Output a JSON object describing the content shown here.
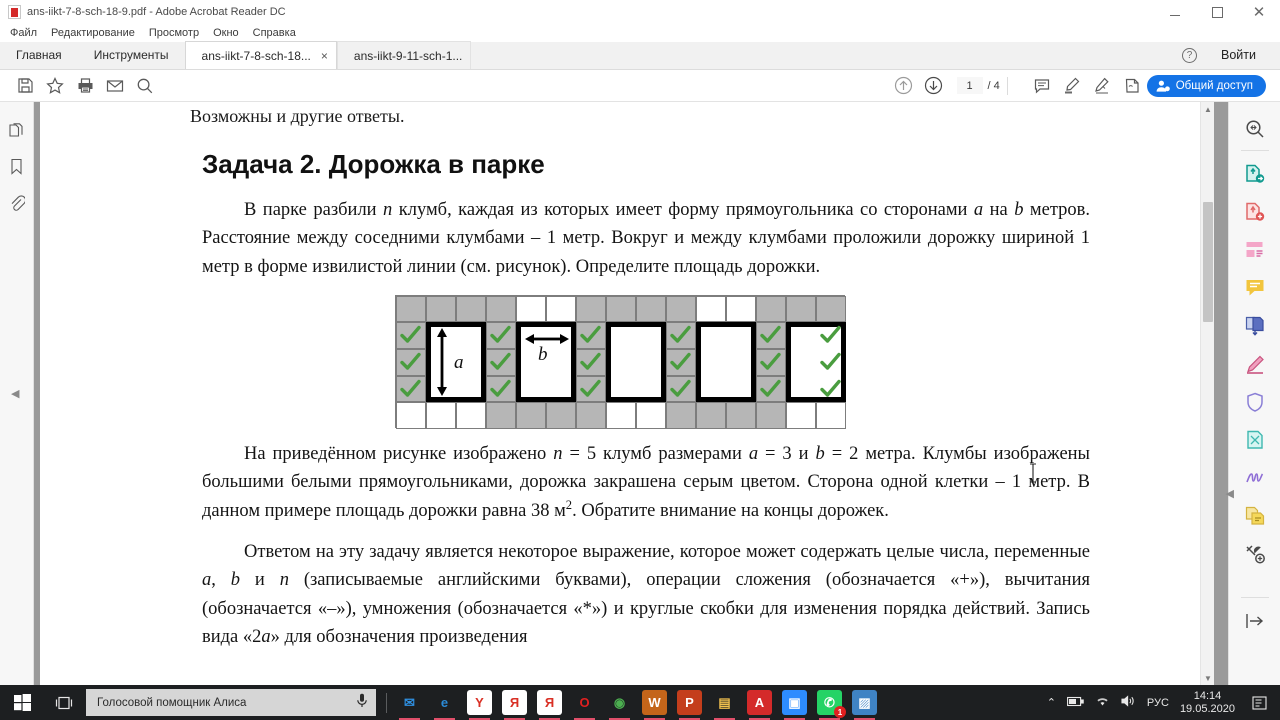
{
  "window": {
    "title": "ans-iikt-7-8-sch-18-9.pdf - Adobe Acrobat Reader DC",
    "app_icon": "pdf-file-icon",
    "controls": {
      "minimize": "minimize-icon",
      "maximize": "maximize-icon",
      "close": "close-icon"
    }
  },
  "menubar": {
    "items": [
      {
        "label": "Файл"
      },
      {
        "label": "Редактирование"
      },
      {
        "label": "Просмотр"
      },
      {
        "label": "Окно"
      },
      {
        "label": "Справка"
      }
    ]
  },
  "tabbar": {
    "home": "Главная",
    "tools": "Инструменты",
    "documents": [
      {
        "label": "ans-iikt-7-8-sch-18...",
        "active": true,
        "close": "×"
      },
      {
        "label": "ans-iikt-9-11-sch-1...",
        "active": false
      }
    ],
    "help": "?",
    "signin": "Войти"
  },
  "toolbar": {
    "icons": [
      "save-icon",
      "star-icon",
      "print-icon",
      "email-icon",
      "zoom-search-icon",
      "scroll-up-icon",
      "scroll-down-icon"
    ],
    "page_current": "1",
    "page_total": "/ 4",
    "right_icons": [
      "comment-icon",
      "highlight-icon",
      "sign-icon",
      "stamp-icon"
    ],
    "share_label": "Общий доступ",
    "share_icon": "share-person-icon",
    "share_color": "#1473e6"
  },
  "left_rail": {
    "icons": [
      "page-thumbnails-icon",
      "bookmark-icon",
      "attachment-icon"
    ],
    "collapse_arrow": "◀"
  },
  "right_rail": {
    "icons": [
      "zoom-search-icon",
      "export-pdf-icon",
      "create-pdf-icon",
      "edit-pdf-icon",
      "comment-icon",
      "combine-files-icon",
      "fill-and-sign-icon",
      "protect-icon",
      "compress-icon",
      "signature-icon",
      "organize-pages-icon",
      "more-tools-icon",
      "collapse-panel-icon"
    ],
    "collapse_arrow": "◀"
  },
  "document": {
    "pre_line": "Возможны и другие ответы.",
    "task_title": "Задача 2. Дорожка в парке",
    "paragraph_1": {
      "runs": [
        {
          "t": "В парке разбили ",
          "i": false
        },
        {
          "t": "n",
          "i": true
        },
        {
          "t": " клумб, каждая из которых имеет форму прямоугольника со сторонами ",
          "i": false
        },
        {
          "t": "a",
          "i": true
        },
        {
          "t": " на ",
          "i": false
        },
        {
          "t": "b",
          "i": true
        },
        {
          "t": " метров. Расстояние между соседними клумбами – 1 метр. Вокруг и между клумбами проложили дорожку шириной 1 метр в форме извилистой линии (см. рисунок). Определите площадь дорожки.",
          "i": false
        }
      ]
    },
    "paragraph_2": {
      "runs": [
        {
          "t": "На приведённом рисунке изображено ",
          "i": false
        },
        {
          "t": "n",
          "i": true
        },
        {
          "t": " = 5 клумб размерами ",
          "i": false
        },
        {
          "t": "a",
          "i": true
        },
        {
          "t": " = 3 и ",
          "i": false
        },
        {
          "t": "b",
          "i": true
        },
        {
          "t": " = 2 метра. Клумбы изображены большими белыми прямоугольниками, дорожка закрашена серым цветом. Сторона одной клетки – 1 метр. В данном примере площадь дорожки равна 38 м",
          "i": false
        },
        {
          "t": "2",
          "i": false,
          "sup": true
        },
        {
          "t": ". Обратите внимание на концы дорожек.",
          "i": false
        }
      ]
    },
    "paragraph_3": {
      "runs": [
        {
          "t": "Ответом на эту задачу является некоторое выражение, которое может содержать целые числа, переменные ",
          "i": false
        },
        {
          "t": "a",
          "i": true
        },
        {
          "t": ", ",
          "i": false
        },
        {
          "t": "b",
          "i": true
        },
        {
          "t": " и ",
          "i": false
        },
        {
          "t": "n",
          "i": true
        },
        {
          "t": " (записываемые английскими буквами), операции сложения (обозначается «+»), вычитания (обозначается «–»), умножения (обозначается «*») и круглые скобки для изменения порядка действий. Запись вида «2",
          "i": false
        },
        {
          "t": "a",
          "i": true
        },
        {
          "t": "» для обозначения произведения",
          "i": false
        }
      ]
    },
    "figure": {
      "label_a": "a",
      "label_b": "b",
      "cols": 15,
      "rows": 5,
      "cell_colors": [
        [
          "grey",
          "grey",
          "grey",
          "grey",
          "white",
          "white",
          "grey",
          "grey",
          "grey",
          "grey",
          "white",
          "white",
          "grey",
          "grey",
          "grey"
        ],
        [
          "grey",
          "grey",
          "grey",
          "grey",
          "grey",
          "grey",
          "grey",
          "grey",
          "grey",
          "grey",
          "grey",
          "grey",
          "grey",
          "grey",
          "grey"
        ],
        [
          "grey",
          "grey",
          "grey",
          "grey",
          "grey",
          "grey",
          "grey",
          "grey",
          "grey",
          "grey",
          "grey",
          "grey",
          "grey",
          "grey",
          "grey"
        ],
        [
          "grey",
          "grey",
          "grey",
          "grey",
          "grey",
          "grey",
          "grey",
          "grey",
          "grey",
          "grey",
          "grey",
          "grey",
          "grey",
          "grey",
          "grey"
        ],
        [
          "white",
          "white",
          "white",
          "grey",
          "grey",
          "grey",
          "grey",
          "white",
          "white",
          "grey",
          "grey",
          "grey",
          "grey",
          "white",
          "white"
        ]
      ],
      "beds": [
        {
          "col": 1,
          "row": 1,
          "w": 2,
          "h": 3
        },
        {
          "col": 4,
          "row": 1,
          "w": 2,
          "h": 3
        },
        {
          "col": 7,
          "row": 1,
          "w": 2,
          "h": 3
        },
        {
          "col": 10,
          "row": 1,
          "w": 2,
          "h": 3
        },
        {
          "col": 13,
          "row": 1,
          "w": 2,
          "h": 3
        }
      ],
      "check_columns": [
        0,
        3,
        6,
        9,
        12,
        15
      ],
      "check_rows": [
        1,
        2,
        3
      ],
      "check_color": "#4a9d3f",
      "grey_color": "#b6b6b6",
      "line_color": "#7d7d7d"
    }
  },
  "taskbar": {
    "start_icon": "windows-start-icon",
    "taskview_icon": "task-view-icon",
    "search_placeholder": "Голосовой помощник Алиса",
    "mic_icon": "microphone-icon",
    "apps": [
      {
        "name": "mail-app-icon",
        "glyph": "✉",
        "color": "#2f8fe0",
        "bg": "transparent"
      },
      {
        "name": "edge-app-icon",
        "glyph": "e",
        "color": "#2b8ad6",
        "bg": "transparent"
      },
      {
        "name": "yandex-browser-app-icon",
        "glyph": "Y",
        "color": "#d93025",
        "bg": "#ffffff"
      },
      {
        "name": "yandex-app-icon",
        "glyph": "Я",
        "color": "#d93025",
        "bg": "#ffffff"
      },
      {
        "name": "yandex-disk-app-icon",
        "glyph": "Я",
        "color": "#d93025",
        "bg": "#ffffff"
      },
      {
        "name": "opera-app-icon",
        "glyph": "O",
        "color": "#e02020",
        "bg": "transparent"
      },
      {
        "name": "chrome-app-icon",
        "glyph": "◉",
        "color": "#4caf50",
        "bg": "transparent"
      },
      {
        "name": "word-app-icon",
        "glyph": "W",
        "color": "#ffffff",
        "bg": "#2b579a"
      },
      {
        "name": "powerpoint-app-icon",
        "glyph": "P",
        "color": "#ffffff",
        "bg": "#c43e1c"
      },
      {
        "name": "explorer-app-icon",
        "glyph": "▤",
        "color": "#f2c14e",
        "bg": "transparent"
      },
      {
        "name": "acrobat-app-icon",
        "glyph": "A",
        "color": "#ffffff",
        "bg": "#d42a2a"
      },
      {
        "name": "zoom-app-icon",
        "glyph": "▣",
        "color": "#ffffff",
        "bg": "#2d8cff"
      },
      {
        "name": "whatsapp-app-icon",
        "glyph": "✆",
        "color": "#ffffff",
        "bg": "#25d366",
        "badge": "1"
      },
      {
        "name": "photos-app-icon",
        "glyph": "▨",
        "color": "#ffffff",
        "bg": "#3f83c4"
      }
    ],
    "tray": {
      "chevron": "⌃",
      "icons": [
        "battery-icon",
        "wifi-icon",
        "volume-icon"
      ],
      "language": "РУС",
      "time": "14:14",
      "date": "19.05.2020",
      "notifications_icon": "notifications-icon"
    }
  }
}
